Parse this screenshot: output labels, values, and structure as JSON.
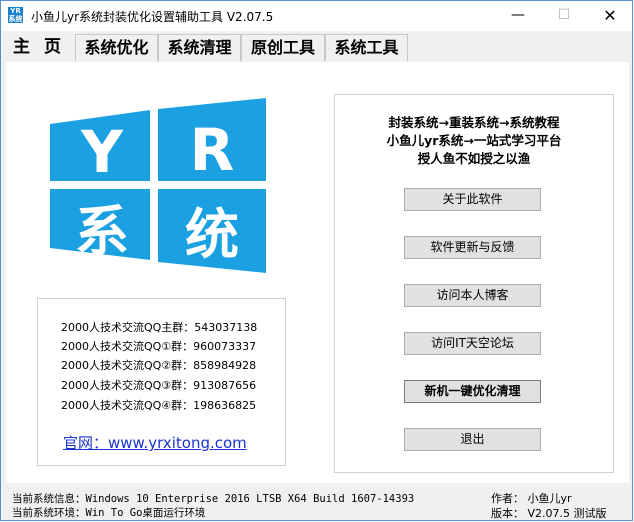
{
  "window": {
    "title": "小鱼儿yr系统封装优化设置辅助工具 V2.07.5",
    "icon_text": "YR系统",
    "minimize": "—",
    "maximize": "☐",
    "close": "✕"
  },
  "tabs": [
    "主 页",
    "系统优化",
    "系统清理",
    "原创工具",
    "系统工具"
  ],
  "logo": {
    "letters": [
      "Y",
      "R",
      "系",
      "统"
    ],
    "color": "#1ba1e2"
  },
  "qq_groups": [
    "2000人技术交流QQ主群：543037138",
    "2000人技术交流QQ①群：960073337",
    "2000人技术交流QQ②群：858984928",
    "2000人技术交流QQ③群：913087656",
    "2000人技术交流QQ④群：198636825"
  ],
  "website": "官网：www.yrxitong.com",
  "slogans": [
    "封装系统→重装系统→系统教程",
    "小鱼儿yr系统→一站式学习平台",
    "授人鱼不如授之以渔"
  ],
  "buttons": [
    "关于此软件",
    "软件更新与反馈",
    "访问本人博客",
    "访问IT天空论坛",
    "新机一键优化清理",
    "退出"
  ],
  "status": {
    "sys_info": "当前系统信息：Windows 10 Enterprise 2016 LTSB X64 Build 1607-14393",
    "sys_env": "当前系统环境：Win To Go桌面运行环境",
    "author": "作者：  小鱼儿yr",
    "version": "版本：  V2.07.5 测试版"
  }
}
